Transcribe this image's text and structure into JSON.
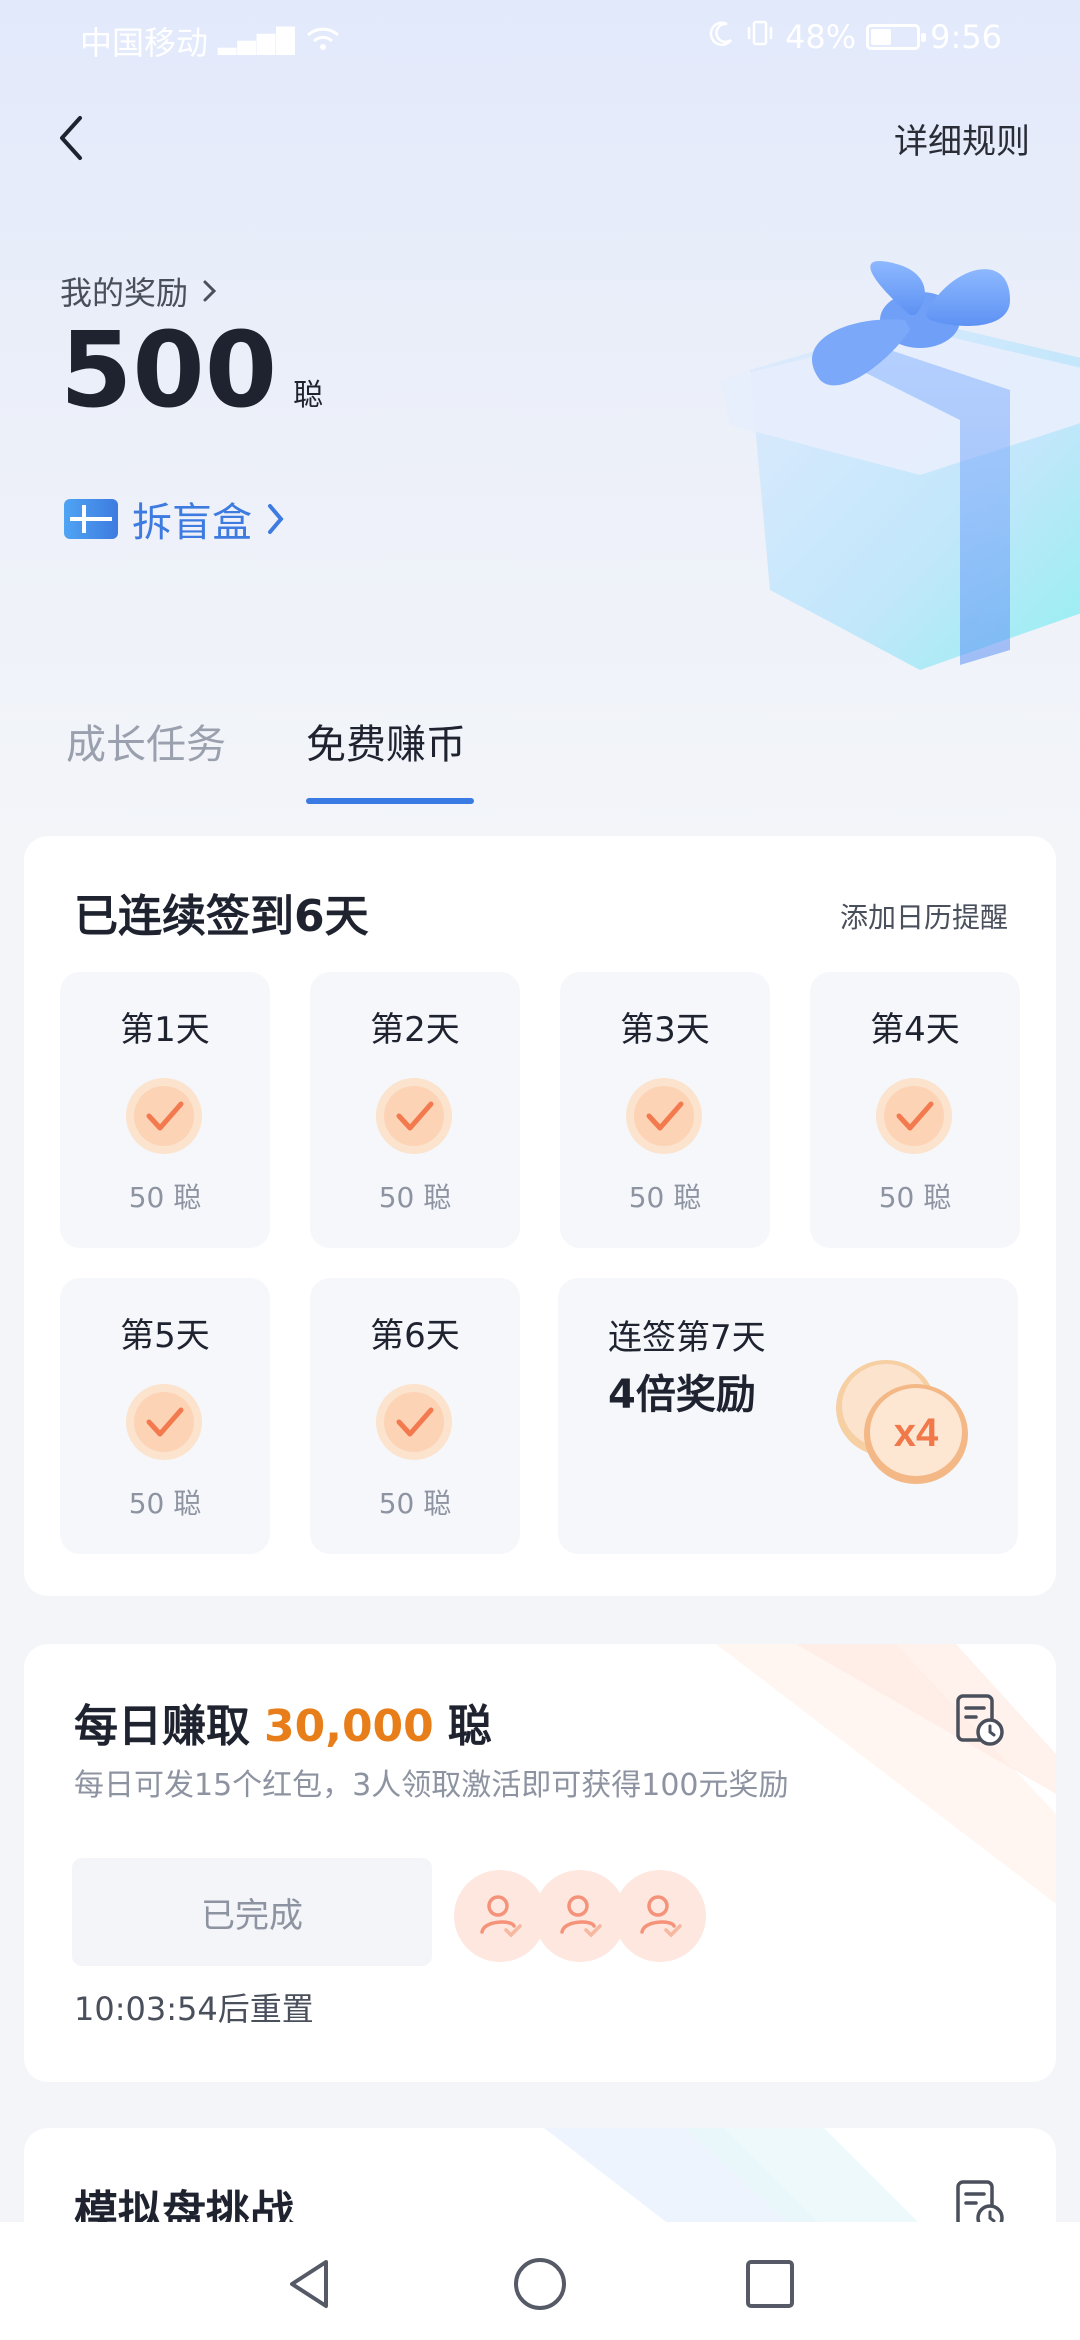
{
  "status_bar": {
    "carrier": "中国移动",
    "network": "4G",
    "battery": "48%",
    "battery_level": 0.48,
    "time": "9:56"
  },
  "header": {
    "back_icon": "chevron-left-icon",
    "rules_label": "详细规则"
  },
  "reward": {
    "label": "我的奖励",
    "value": "500",
    "unit": "聪",
    "blindbox_label": "拆盲盒"
  },
  "tabs": [
    {
      "label": "成长任务",
      "active": false
    },
    {
      "label": "免费赚币",
      "active": true
    }
  ],
  "checkin": {
    "title": "已连续签到6天",
    "calendar_reminder": "添加日历提醒",
    "days": [
      {
        "label": "第1天",
        "amount": "50 聪",
        "checked": true
      },
      {
        "label": "第2天",
        "amount": "50 聪",
        "checked": true
      },
      {
        "label": "第3天",
        "amount": "50 聪",
        "checked": true
      },
      {
        "label": "第4天",
        "amount": "50 聪",
        "checked": true
      },
      {
        "label": "第5天",
        "amount": "50 聪",
        "checked": true
      },
      {
        "label": "第6天",
        "amount": "50 聪",
        "checked": true
      }
    ],
    "bonus": {
      "line1": "连签第7天",
      "line2": "4倍奖励",
      "multiplier": "x4"
    }
  },
  "daily_task": {
    "title_prefix": "每日赚取",
    "amount": "30,000",
    "unit": "聪",
    "subtitle": "每日可发15个红包，3人领取激活即可获得100元奖励",
    "button_label": "已完成",
    "reset_text": "10:03:54后重置"
  },
  "simulation": {
    "title": "模拟盘挑战"
  },
  "colors": {
    "accent": "#3a7be3",
    "amount": "#e87e1a",
    "check_orange": "#f27a4e"
  }
}
